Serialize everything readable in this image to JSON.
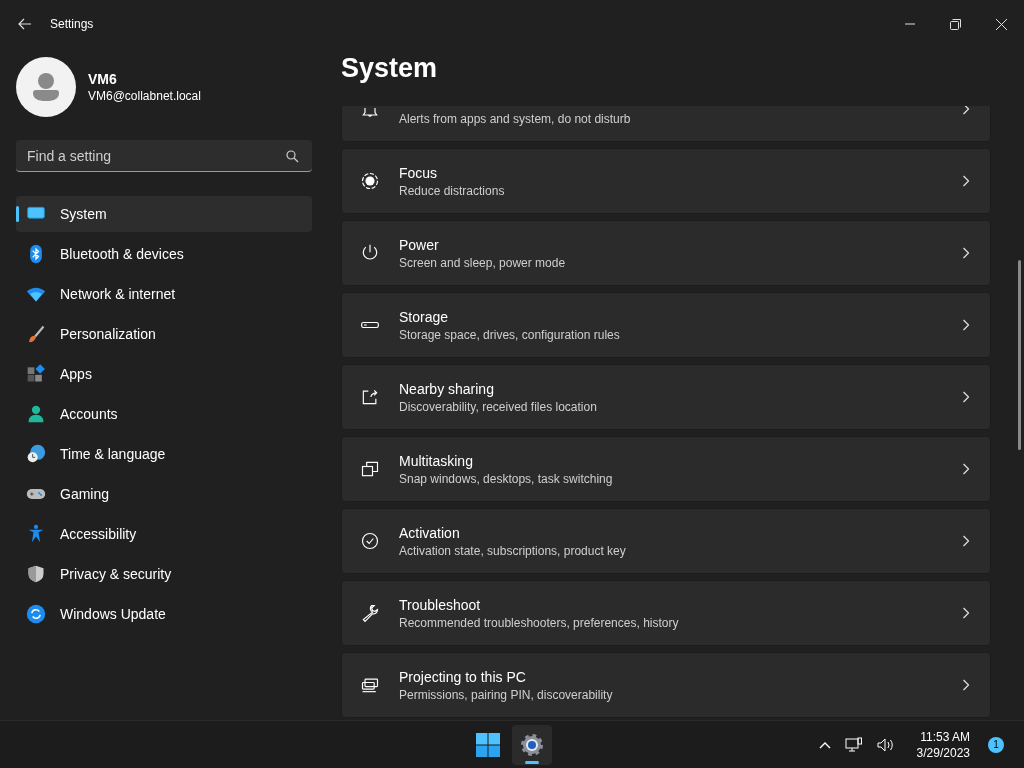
{
  "window": {
    "title": "Settings"
  },
  "profile": {
    "name": "VM6",
    "email": "VM6@collabnet.local"
  },
  "search": {
    "placeholder": "Find a setting"
  },
  "sidebar": {
    "items": [
      {
        "label": "System",
        "selected": true
      },
      {
        "label": "Bluetooth & devices",
        "selected": false
      },
      {
        "label": "Network & internet",
        "selected": false
      },
      {
        "label": "Personalization",
        "selected": false
      },
      {
        "label": "Apps",
        "selected": false
      },
      {
        "label": "Accounts",
        "selected": false
      },
      {
        "label": "Time & language",
        "selected": false
      },
      {
        "label": "Gaming",
        "selected": false
      },
      {
        "label": "Accessibility",
        "selected": false
      },
      {
        "label": "Privacy & security",
        "selected": false
      },
      {
        "label": "Windows Update",
        "selected": false
      }
    ]
  },
  "page": {
    "title": "System"
  },
  "cards": [
    {
      "subtitle": "Alerts from apps and system, do not disturb"
    },
    {
      "title": "Focus",
      "subtitle": "Reduce distractions"
    },
    {
      "title": "Power",
      "subtitle": "Screen and sleep, power mode"
    },
    {
      "title": "Storage",
      "subtitle": "Storage space, drives, configuration rules"
    },
    {
      "title": "Nearby sharing",
      "subtitle": "Discoverability, received files location"
    },
    {
      "title": "Multitasking",
      "subtitle": "Snap windows, desktops, task switching"
    },
    {
      "title": "Activation",
      "subtitle": "Activation state, subscriptions, product key"
    },
    {
      "title": "Troubleshoot",
      "subtitle": "Recommended troubleshooters, preferences, history"
    },
    {
      "title": "Projecting to this PC",
      "subtitle": "Permissions, pairing PIN, discoverability"
    }
  ],
  "taskbar": {
    "time": "11:53 AM",
    "date": "3/29/2023",
    "notification_count": "1"
  }
}
